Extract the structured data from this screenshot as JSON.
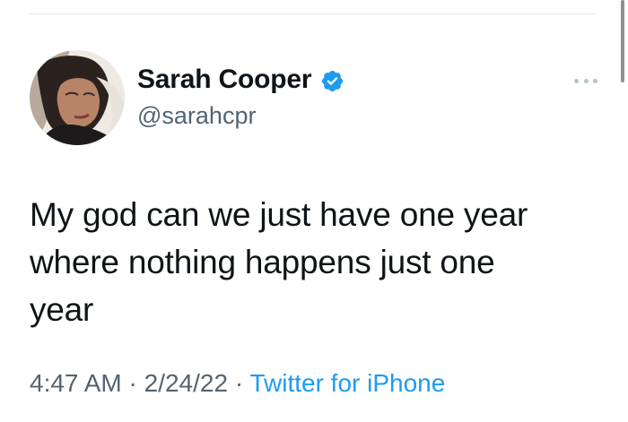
{
  "user": {
    "display_name": "Sarah Cooper",
    "handle": "@sarahcpr",
    "verified": true,
    "verified_color": "#1d9bf0"
  },
  "tweet": {
    "lines": [
      "My god can we just have one year",
      "where nothing happens just one",
      "year"
    ],
    "time": "4:47 AM",
    "separator": "·",
    "date": "2/24/22",
    "source": "Twitter for iPhone"
  },
  "icons": {
    "more": "more-options-icon",
    "verified": "verified-badge-icon"
  },
  "colors": {
    "text_primary": "#0f1419",
    "text_secondary": "#536471",
    "link": "#1d9bf0"
  }
}
